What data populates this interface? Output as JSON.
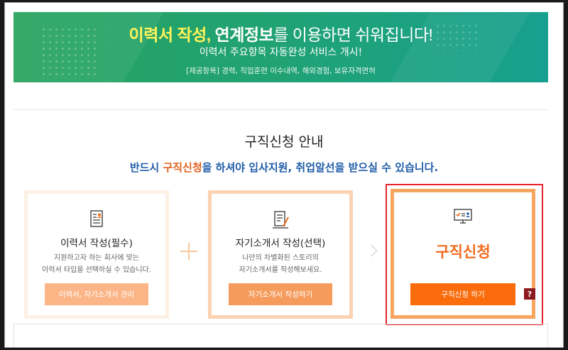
{
  "banner": {
    "title_part1": "이력서 작성, ",
    "title_part2": "연계정보",
    "title_part3": "를 이용하면 쉬워집니다!",
    "subtitle": "이력서 주요항목 자동완성 서비스 개시!",
    "note": "[제공항목] 경력, 직업훈련 이수내역, 해외경험, 보유자격면허"
  },
  "section": {
    "title": "구직신청 안내",
    "desc_part1": "반드시 ",
    "desc_highlight": "구직신청",
    "desc_part2": "을 하셔야 입사지원, 취업알선을 받으실 수 있습니다."
  },
  "cards": [
    {
      "title": "이력서 작성(필수)",
      "desc_line1": "지원하고자 하는 회사에 맞는",
      "desc_line2": "이력서 타입을 선택하실 수 있습니다.",
      "button": "이력서, 자기소개서 관리",
      "icon": "resume-icon"
    },
    {
      "title": "자기소개서 작성(선택)",
      "desc_line1": "나만의 차별화된 스토리의",
      "desc_line2": "자기소개서를 작성해보세요.",
      "button": "자기소개서 작성하기",
      "icon": "cover-letter-icon"
    },
    {
      "title": "구직신청",
      "button": "구직신청 하기",
      "help": "?",
      "icon": "monitor-check-icon"
    }
  ],
  "colors": {
    "banner_green": "#27a35d",
    "accent_orange": "#fb6c0c",
    "desc_blue": "#1f5ca8",
    "highlight_red": "#e8222a"
  }
}
